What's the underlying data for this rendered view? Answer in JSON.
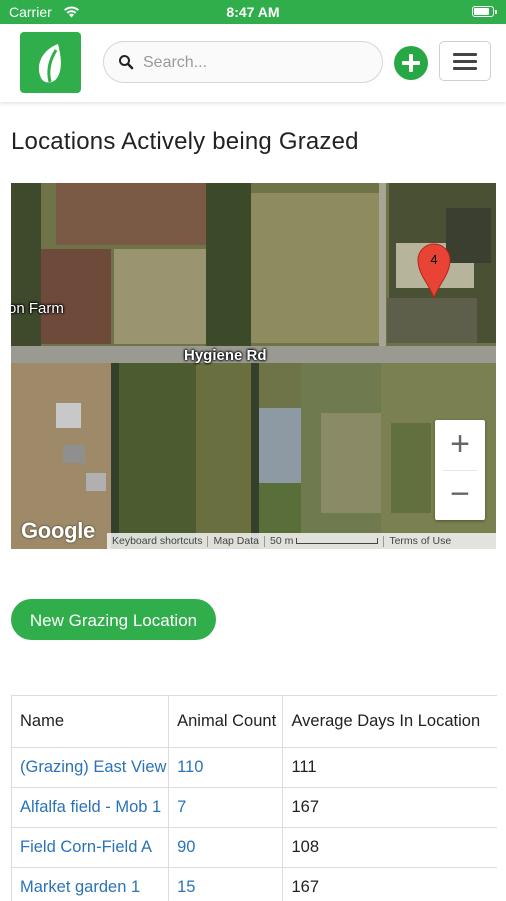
{
  "status_bar": {
    "carrier": "Carrier",
    "time": "8:47 AM"
  },
  "header": {
    "logo_icon": "leaf-icon",
    "search": {
      "placeholder": "Search...",
      "value": ""
    },
    "add_icon": "plus-circle-icon",
    "menu_icon": "hamburger-menu-icon"
  },
  "page": {
    "title": "Locations Actively being Grazed"
  },
  "map": {
    "road_label": "Hygiene Rd",
    "farm_label": "on Farm",
    "marker_label": "4",
    "zoom_in": "+",
    "zoom_out": "−",
    "provider": "Google",
    "attribution": {
      "keyboard_shortcuts": "Keyboard shortcuts",
      "map_data": "Map Data",
      "scale": "50 m",
      "terms": "Terms of Use"
    }
  },
  "actions": {
    "new_location": "New Grazing Location"
  },
  "table": {
    "headers": [
      "Name",
      "Animal Count",
      "Average Days In Location"
    ],
    "rows": [
      {
        "name": "(Grazing) East View",
        "count": "110",
        "days": "111"
      },
      {
        "name": "Alfalfa field - Mob 1",
        "count": "7",
        "days": "167"
      },
      {
        "name": "Field Corn-Field A",
        "count": "90",
        "days": "108"
      },
      {
        "name": "Market garden 1",
        "count": "15",
        "days": "167"
      }
    ]
  },
  "colors": {
    "brand_green": "#2fae4b",
    "link_blue": "#2a73b8",
    "marker_red": "#e94335"
  }
}
